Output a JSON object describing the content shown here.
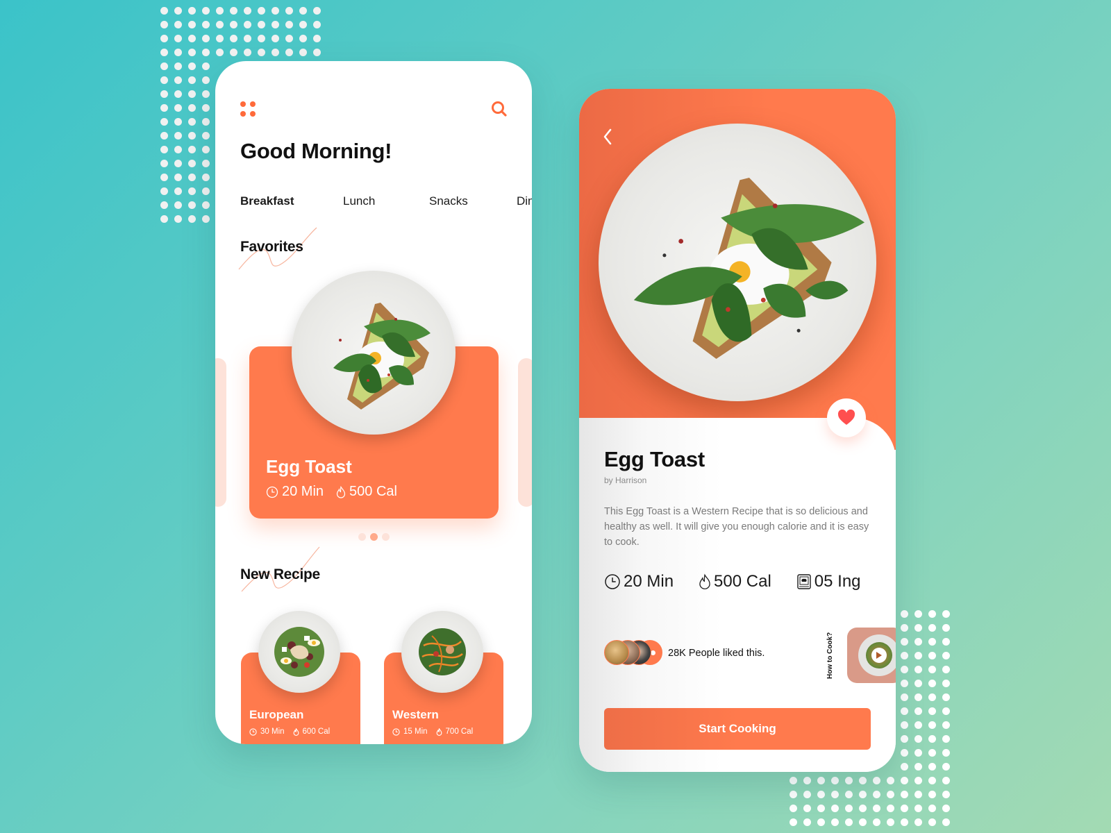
{
  "colors": {
    "accent": "#ff7a4d",
    "accent_light": "#fde2d9",
    "heart": "#ff4f4f",
    "background_start": "#3bc3c9",
    "background_end": "#a3dab3"
  },
  "home_screen": {
    "menu_icon": "grid-dots-icon",
    "search_icon": "search-icon",
    "greeting": "Good Morning!",
    "tabs": [
      {
        "label": "Breakfast",
        "active": true
      },
      {
        "label": "Lunch",
        "active": false
      },
      {
        "label": "Snacks",
        "active": false
      },
      {
        "label": "Dinner",
        "active": false
      }
    ],
    "favorites": {
      "title": "Favorites",
      "card": {
        "name": "Egg Toast",
        "time": "20 Min",
        "calories": "500 Cal"
      },
      "carousel": {
        "count": 3,
        "active_index": 1
      }
    },
    "new_recipe": {
      "title": "New Recipe",
      "cards": [
        {
          "name": "European",
          "time": "30 Min",
          "calories": "600 Cal"
        },
        {
          "name": "Western",
          "time": "15 Min",
          "calories": "700 Cal"
        }
      ]
    }
  },
  "detail_screen": {
    "back_icon": "chevron-left-icon",
    "favorite_icon": "heart-icon",
    "title": "Egg Toast",
    "author": "by Harrison",
    "description": "This Egg Toast is a Western Recipe that is so delicious and healthy as well. It will give you enough calorie and it is easy to cook.",
    "stats": {
      "time": "20 Min",
      "calories": "500 Cal",
      "ingredients": "05 Ing"
    },
    "likes_text": "28K People liked this.",
    "how_to_label": "How to Cook?",
    "start_button": "Start Cooking"
  }
}
